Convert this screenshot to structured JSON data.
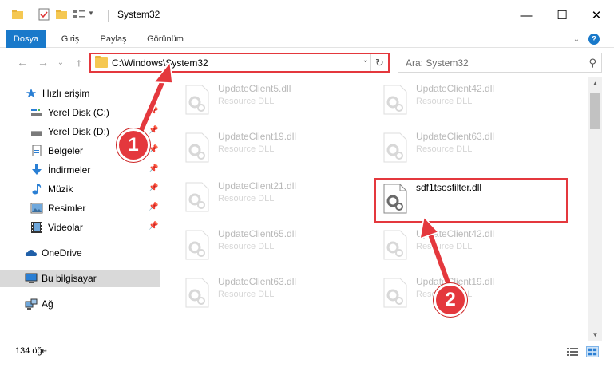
{
  "window": {
    "title": "System32",
    "controls": {
      "minimize": "—",
      "maximize": "☐",
      "close": "✕"
    }
  },
  "ribbon": {
    "tabs": [
      "Dosya",
      "Giriş",
      "Paylaş",
      "Görünüm"
    ],
    "help": "?"
  },
  "navigation": {
    "back": "←",
    "forward": "→",
    "recent": "⌄",
    "up": "↑",
    "address": "C:\\Windows\\System32",
    "search_placeholder": "Ara: System32"
  },
  "sidebar": {
    "quick_access": "Hızlı erişim",
    "pinned": [
      {
        "label": "Yerel Disk (C:)",
        "icon": "drive-icon"
      },
      {
        "label": "Yerel Disk (D:)",
        "icon": "drive-icon"
      },
      {
        "label": "Belgeler",
        "icon": "documents-icon"
      },
      {
        "label": "İndirmeler",
        "icon": "download-icon"
      },
      {
        "label": "Müzik",
        "icon": "music-icon"
      },
      {
        "label": "Resimler",
        "icon": "pictures-icon"
      },
      {
        "label": "Videolar",
        "icon": "videos-icon"
      }
    ],
    "onedrive": "OneDrive",
    "this_pc": "Bu bilgisayar",
    "network": "Ağ"
  },
  "files": {
    "left": [
      {
        "name": "UpdateClient5.dll",
        "type": "Resource DLL"
      },
      {
        "name": "UpdateClient19.dll",
        "type": "Resource DLL"
      },
      {
        "name": "UpdateClient21.dll",
        "type": "Resource DLL"
      },
      {
        "name": "UpdateClient65.dll",
        "type": "Resource DLL"
      },
      {
        "name": "UpdateClient63.dll",
        "type": "Resource DLL"
      }
    ],
    "right": [
      {
        "name": "UpdateClient42.dll",
        "type": "Resource DLL"
      },
      {
        "name": "UpdateClient63.dll",
        "type": "Resource DLL"
      },
      {
        "name": "sdf1tsosfilter.dll",
        "type": ""
      },
      {
        "name": "UpdateClient42.dll",
        "type": "Resource DLL"
      },
      {
        "name": "UpdateClient19.dll",
        "type": "Resource DLL"
      }
    ]
  },
  "status": {
    "item_count": "134 öğe"
  },
  "annotations": {
    "step1": "1",
    "step2": "2"
  },
  "colors": {
    "accent": "#1979ca",
    "highlight": "#e4383d"
  }
}
